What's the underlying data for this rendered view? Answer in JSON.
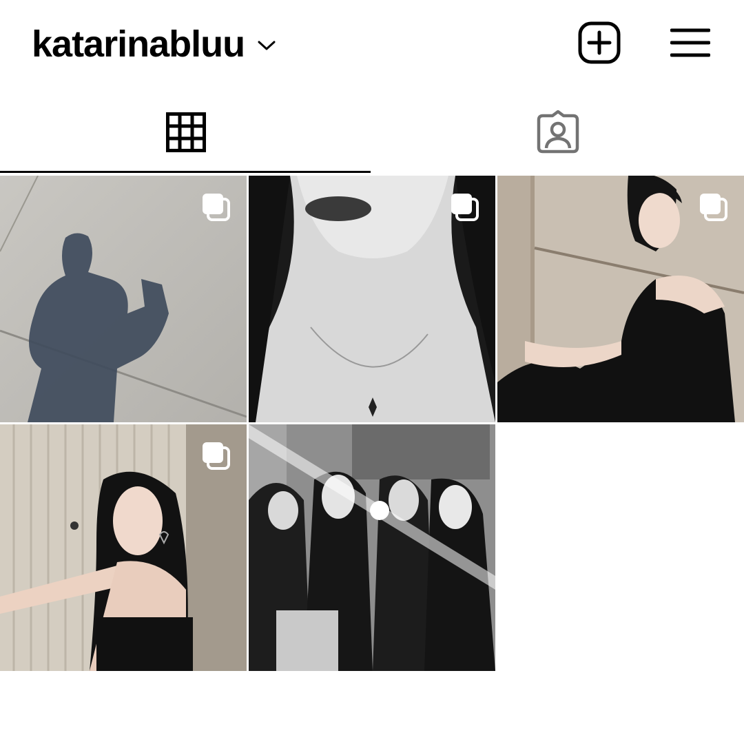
{
  "header": {
    "username": "katarinabluu",
    "dropdown_icon": "chevron-down-icon",
    "new_post_icon": "plus-square-icon",
    "menu_icon": "hamburger-menu-icon"
  },
  "tabs": [
    {
      "name": "posts-grid",
      "icon": "grid-icon",
      "active": true
    },
    {
      "name": "tagged",
      "icon": "tagged-person-icon",
      "active": false
    }
  ],
  "posts": [
    {
      "subject": "shadow-on-pavement",
      "multi": true
    },
    {
      "subject": "necklace-closeup-bw",
      "multi": true
    },
    {
      "subject": "black-tulle-dress",
      "multi": true
    },
    {
      "subject": "profile-heart-earring",
      "multi": true
    },
    {
      "subject": "group-mirror-selfie-bw",
      "multi": false
    }
  ],
  "colors": {
    "background": "#ffffff",
    "text": "#000000",
    "inactive_icon": "#737373"
  }
}
